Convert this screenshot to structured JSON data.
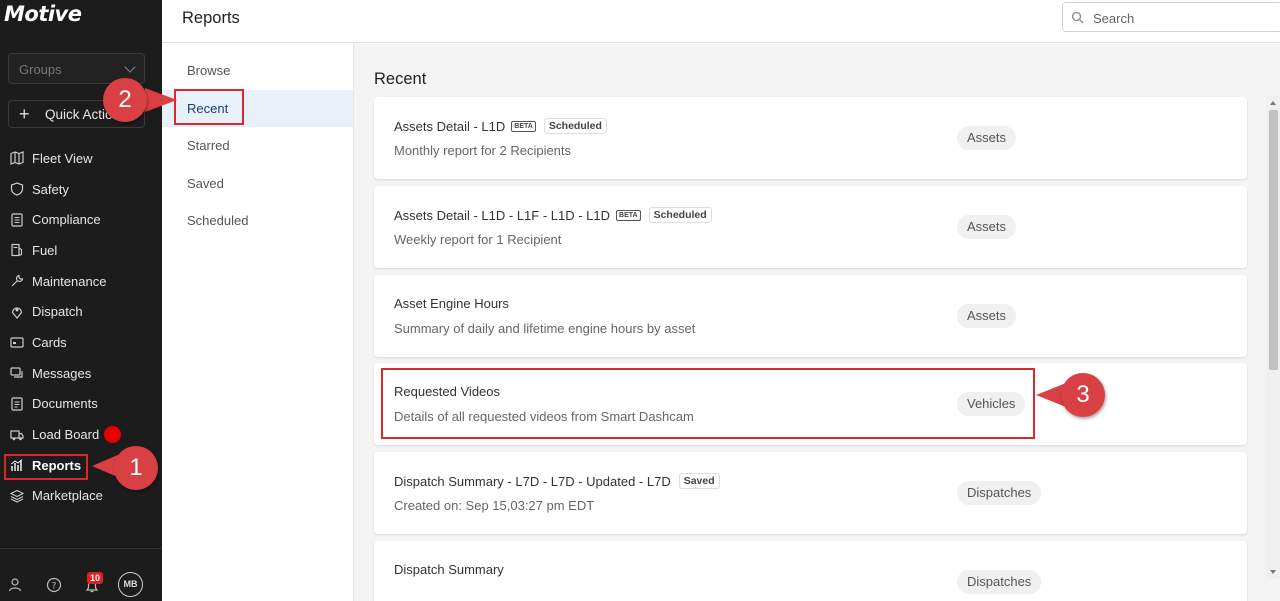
{
  "app": {
    "logo": "Motive"
  },
  "sidebar": {
    "groups_placeholder": "Groups",
    "quick_action": "Quick Actions",
    "items": [
      {
        "label": "Fleet View",
        "icon": "map-icon"
      },
      {
        "label": "Safety",
        "icon": "shield-icon"
      },
      {
        "label": "Compliance",
        "icon": "document-list-icon"
      },
      {
        "label": "Fuel",
        "icon": "fuel-pump-icon"
      },
      {
        "label": "Maintenance",
        "icon": "wrench-icon"
      },
      {
        "label": "Dispatch",
        "icon": "location-pin-icon"
      },
      {
        "label": "Cards",
        "icon": "card-icon"
      },
      {
        "label": "Messages",
        "icon": "chat-icon"
      },
      {
        "label": "Documents",
        "icon": "document-icon"
      },
      {
        "label": "Load Board",
        "icon": "truck-icon"
      },
      {
        "label": "Reports",
        "icon": "bar-chart-icon",
        "active": true
      },
      {
        "label": "Marketplace",
        "icon": "layers-icon"
      }
    ],
    "notification_count": "10",
    "avatar_initials": "MB"
  },
  "header": {
    "title": "Reports",
    "search_placeholder": "Search"
  },
  "subnav": {
    "items": [
      "Browse",
      "Recent",
      "Starred",
      "Saved",
      "Scheduled"
    ],
    "active": "Recent"
  },
  "main": {
    "heading": "Recent",
    "reports": [
      {
        "name": "Assets Detail - L1D",
        "beta": "BETA",
        "status": "Scheduled",
        "description": "Monthly report for 2 Recipients",
        "category": "Assets"
      },
      {
        "name": "Assets Detail - L1D - L1F - L1D - L1D",
        "beta": "BETA",
        "status": "Scheduled",
        "description": "Weekly report for 1 Recipient",
        "category": "Assets"
      },
      {
        "name": "Asset Engine Hours",
        "beta": "",
        "status": "",
        "description": "Summary of daily and lifetime engine hours by asset",
        "category": "Assets"
      },
      {
        "name": "Requested Videos",
        "beta": "",
        "status": "",
        "description": "Details of all requested videos from Smart Dashcam",
        "category": "Vehicles"
      },
      {
        "name": "Dispatch Summary - L7D - L7D - Updated - L7D",
        "beta": "",
        "status": "Saved",
        "description": "Created on: Sep 15,03:27 pm EDT",
        "category": "Dispatches"
      },
      {
        "name": "Dispatch Summary",
        "beta": "",
        "status": "",
        "description": "",
        "category": "Dispatches"
      }
    ]
  },
  "annotations": {
    "callout_1": "1",
    "callout_2": "2",
    "callout_3": "3"
  },
  "colors": {
    "sidebar_bg": "#1c1c1c",
    "accent_red": "#d94044",
    "active_subnav_bg": "#e8f1fa"
  }
}
